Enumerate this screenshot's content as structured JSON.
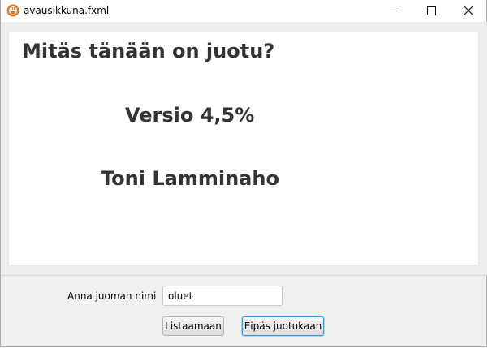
{
  "window": {
    "title": "avausikkuna.fxml",
    "icon": "java-cup-icon",
    "controls": [
      "minimize-icon",
      "maximize-icon",
      "close-icon"
    ]
  },
  "panel": {
    "heading": "Mitäs tänään on juotu?",
    "version": "Versio 4,5%",
    "author": "Toni Lamminaho"
  },
  "form": {
    "drink_label": "Anna juoman nimi",
    "drink_value": "oluet",
    "list_button": "Listaamaan",
    "cancel_button": "Eipäs juotukaan"
  }
}
